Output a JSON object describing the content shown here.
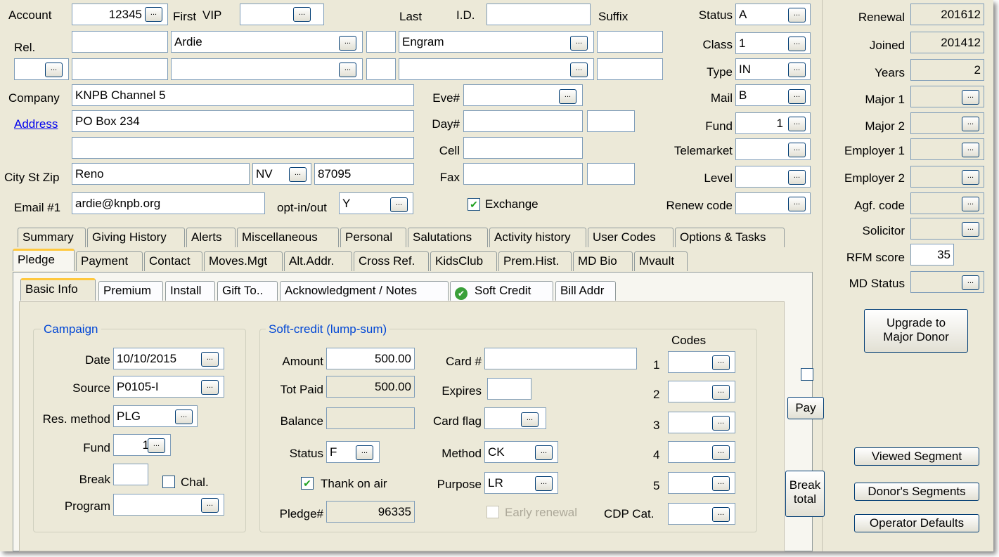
{
  "header": {
    "account_label": "Account",
    "account_value": "12345",
    "first_label": "First",
    "vip_label": "VIP",
    "vip_value": "",
    "last_label": "Last",
    "id_label": "I.D.",
    "id_value": "",
    "suffix_label": "Suffix",
    "rel_label": "Rel.",
    "first_value": "Ardie",
    "last_value": "Engram",
    "company_label": "Company",
    "company_value": "KNPB Channel 5",
    "address_label": "Address",
    "address1": "PO Box 234",
    "address2": "",
    "city_label": "City St Zip",
    "city": "Reno",
    "state": "NV",
    "zip": "87095",
    "email_label": "Email #1",
    "email": "ardie@knpb.org",
    "optin_label": "opt-in/out",
    "optin_value": "Y",
    "eve_label": "Eve#",
    "day_label": "Day#",
    "cell_label": "Cell",
    "fax_label": "Fax",
    "exchange_label": "Exchange"
  },
  "codes_right": {
    "status_label": "Status",
    "status_value": "A",
    "class_label": "Class",
    "class_value": "1",
    "type_label": "Type",
    "type_value": "IN",
    "mail_label": "Mail",
    "mail_value": "B",
    "fund_label": "Fund",
    "fund_value": "1",
    "telemarket_label": "Telemarket",
    "level_label": "Level",
    "renew_label": "Renew code"
  },
  "far_right": {
    "renewal_label": "Renewal",
    "renewal_value": "201612",
    "joined_label": "Joined",
    "joined_value": "201412",
    "years_label": "Years",
    "years_value": "2",
    "major1_label": "Major 1",
    "major2_label": "Major 2",
    "employer1_label": "Employer 1",
    "employer2_label": "Employer 2",
    "agf_label": "Agf. code",
    "solicitor_label": "Solicitor",
    "rfm_label": "RFM score",
    "rfm_value": "35",
    "mdstatus_label": "MD Status",
    "upgrade_line1": "Upgrade to",
    "upgrade_line2": "Major Donor",
    "viewed_segment": "Viewed Segment",
    "donors_segments": "Donor's Segments",
    "operator_defaults": "Operator Defaults"
  },
  "tabs_row1": [
    "Summary",
    "Giving History",
    "Alerts",
    "Miscellaneous",
    "Personal",
    "Salutations",
    "Activity history",
    "User Codes",
    "Options & Tasks"
  ],
  "tabs_row2": [
    "Pledge",
    "Payment",
    "Contact",
    "Moves.Mgt",
    "Alt.Addr.",
    "Cross Ref.",
    "KidsClub",
    "Prem.Hist.",
    "MD Bio",
    "Mvault"
  ],
  "subtabs": [
    "Basic Info",
    "Premium",
    "Install",
    "Gift To..",
    "Acknowledgment / Notes",
    "Soft Credit",
    "Bill Addr"
  ],
  "campaign": {
    "title": "Campaign",
    "date_label": "Date",
    "date": "10/10/2015",
    "source_label": "Source",
    "source": "P0105-I",
    "resmethod_label": "Res. method",
    "resmethod": "PLG",
    "fund_label": "Fund",
    "fund": "1",
    "break_label": "Break",
    "chal_label": "Chal.",
    "program_label": "Program"
  },
  "softcredit": {
    "title": "Soft-credit (lump-sum)",
    "amount_label": "Amount",
    "amount": "500.00",
    "totpaid_label": "Tot Paid",
    "totpaid": "500.00",
    "balance_label": "Balance",
    "status_label": "Status",
    "status": "F",
    "thank_label": "Thank on air",
    "pledge_label": "Pledge#",
    "pledge": "96335",
    "card_label": "Card #",
    "expires_label": "Expires",
    "cardflag_label": "Card flag",
    "method_label": "Method",
    "method": "CK",
    "purpose_label": "Purpose",
    "purpose": "LR",
    "early_label": "Early renewal",
    "cdp_label": "CDP Cat.",
    "codes_label": "Codes",
    "code_numbers": [
      "1",
      "2",
      "3",
      "4",
      "5"
    ]
  },
  "side_buttons": {
    "pay": "Pay",
    "break_line1": "Break",
    "break_line2": "total"
  },
  "ellipsis": "..."
}
